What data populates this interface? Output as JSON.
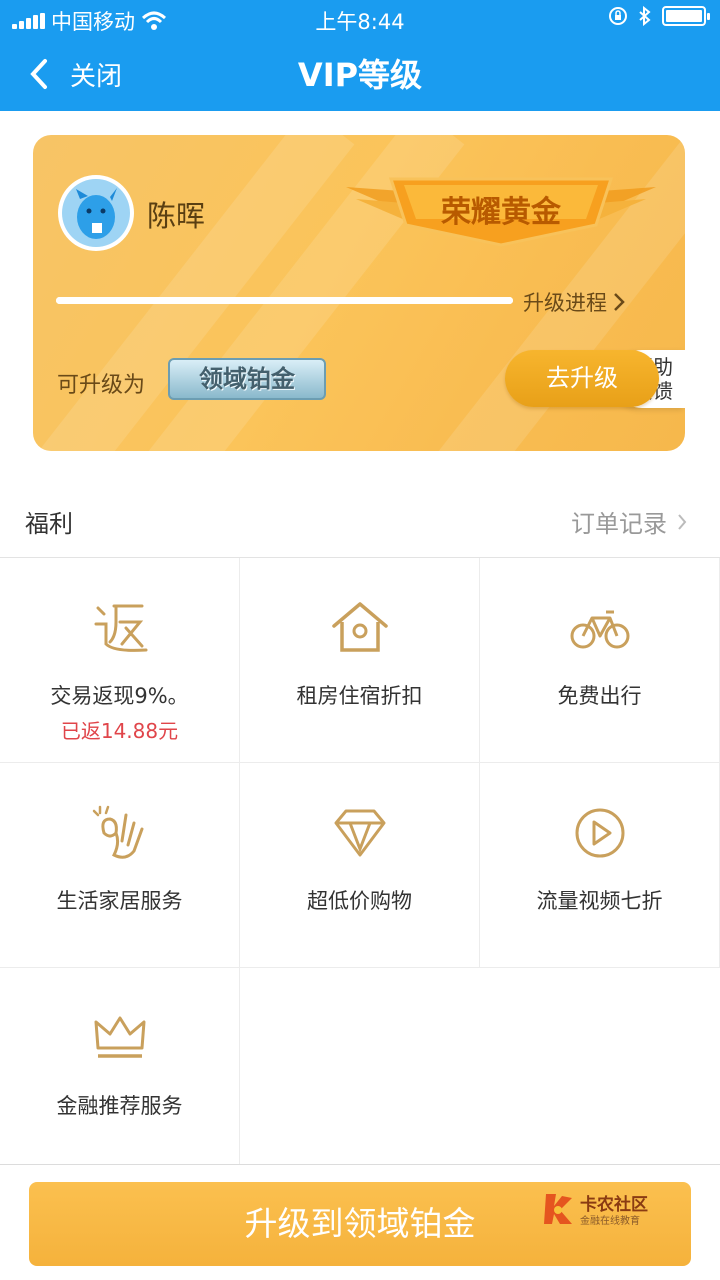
{
  "status_bar": {
    "carrier": "中国移动",
    "time": "上午8:44"
  },
  "nav": {
    "back_label": "关闭",
    "title": "VIP等级"
  },
  "card": {
    "username": "陈晖",
    "current_level": "荣耀黄金",
    "help_label_line1": "帮助",
    "help_label_line2": "反馈",
    "progress_link": "升级进程",
    "progress_fraction": 1.0,
    "upgrade_to_label": "可升级为",
    "next_level": "领域铂金",
    "go_upgrade_button": "去升级"
  },
  "benefits": {
    "title": "福利",
    "order_link": "订单记录",
    "items": [
      {
        "icon": "fan-char-icon",
        "label": "交易返现9%。",
        "sub": "已返14.88元"
      },
      {
        "icon": "house-icon",
        "label": "租房住宿折扣"
      },
      {
        "icon": "bicycle-icon",
        "label": "免费出行"
      },
      {
        "icon": "ok-hand-icon",
        "label": "生活家居服务"
      },
      {
        "icon": "diamond-icon",
        "label": "超低价购物"
      },
      {
        "icon": "play-icon",
        "label": "流量视频七折"
      },
      {
        "icon": "crown-icon",
        "label": "金融推荐服务"
      }
    ]
  },
  "cta": {
    "label": "升级到领域铂金"
  },
  "watermark": {
    "line1": "卡农社区",
    "line2": "金融在线教育"
  },
  "colors": {
    "nav_blue": "#1a9cf0",
    "gold": "#fbc45a",
    "icon_gold": "#c9a05c",
    "red": "#e0454a"
  }
}
